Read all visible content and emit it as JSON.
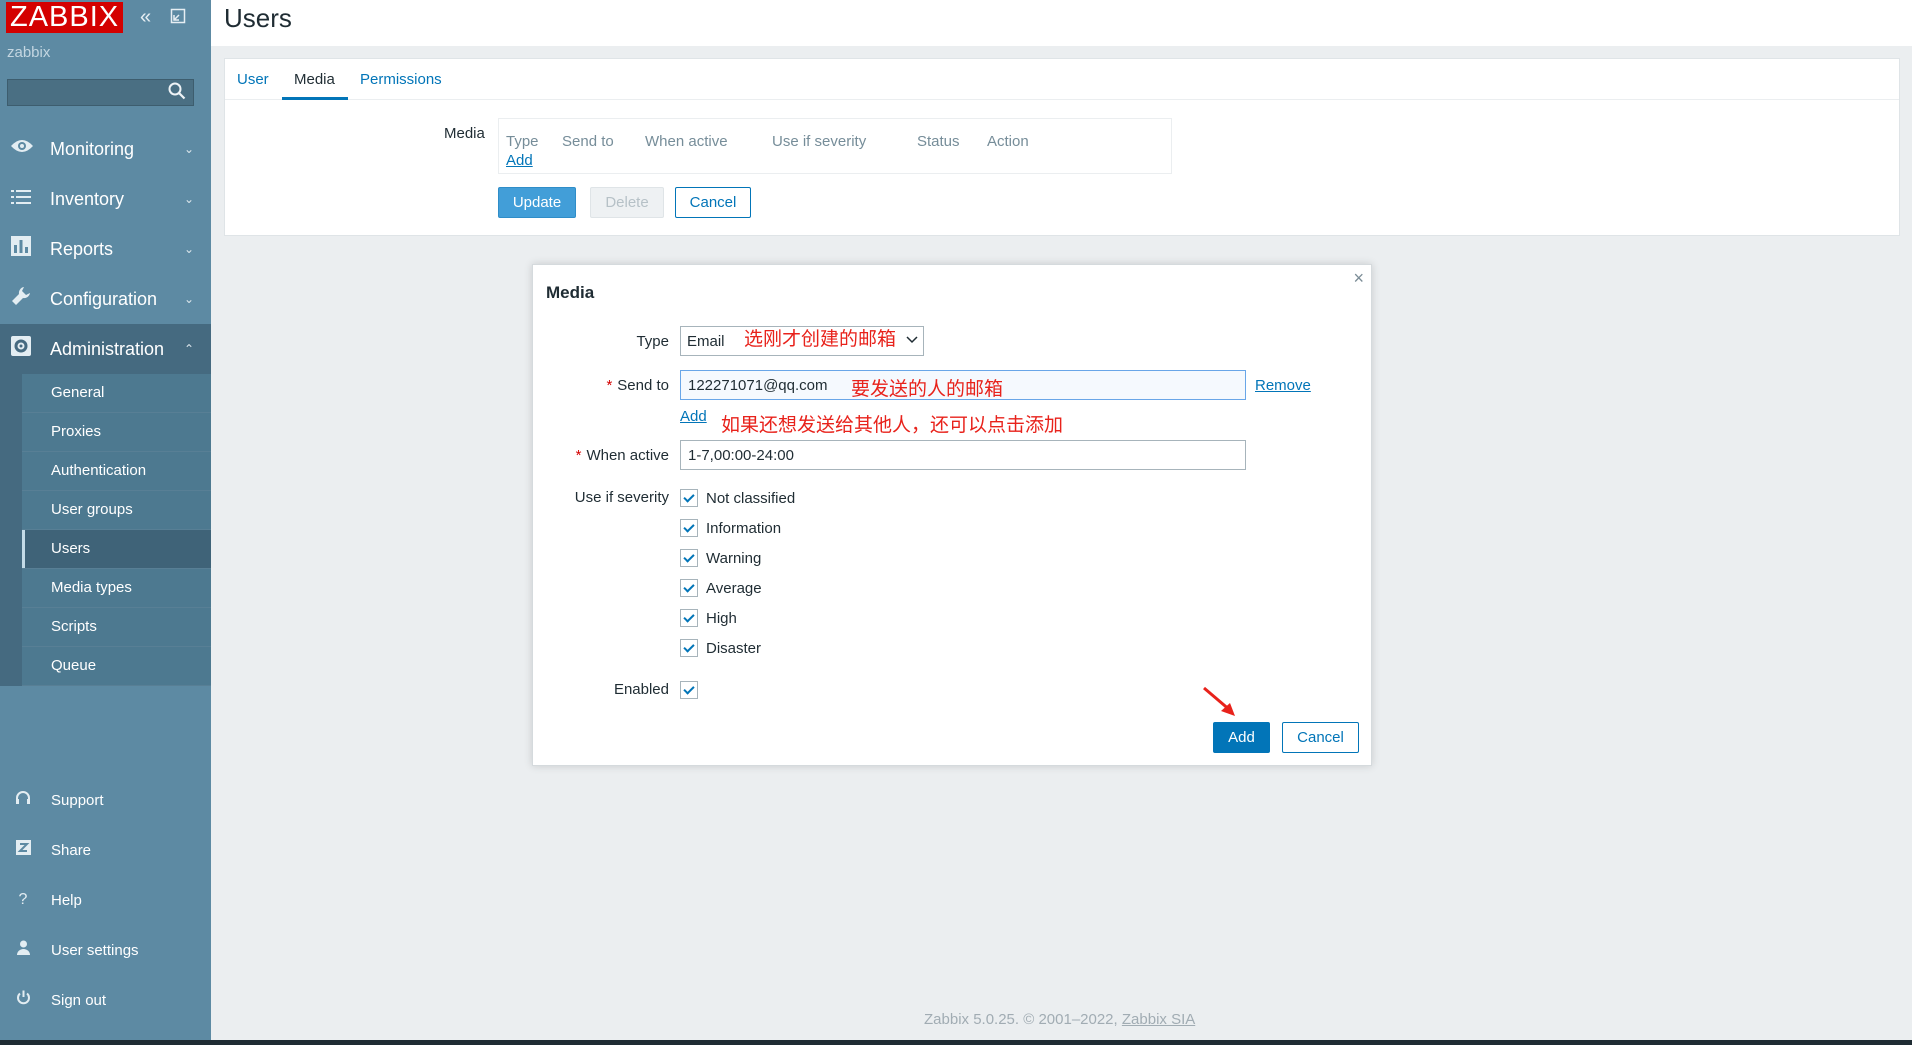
{
  "sidebar": {
    "logo": "ZABBIX",
    "server": "zabbix",
    "menu": [
      {
        "label": "Monitoring",
        "icon": "eye-icon"
      },
      {
        "label": "Inventory",
        "icon": "list-icon"
      },
      {
        "label": "Reports",
        "icon": "bar-chart-icon"
      },
      {
        "label": "Configuration",
        "icon": "wrench-icon"
      },
      {
        "label": "Administration",
        "icon": "gear-icon"
      }
    ],
    "submenu": [
      "General",
      "Proxies",
      "Authentication",
      "User groups",
      "Users",
      "Media types",
      "Scripts",
      "Queue"
    ],
    "selected_submenu": "Users",
    "bottom": [
      {
        "label": "Support",
        "icon": "headset-icon"
      },
      {
        "label": "Share",
        "icon": "share-z-icon"
      },
      {
        "label": "Help",
        "icon": "help-icon"
      },
      {
        "label": "User settings",
        "icon": "user-icon"
      },
      {
        "label": "Sign out",
        "icon": "power-icon"
      }
    ]
  },
  "header": {
    "title": "Users"
  },
  "tabs": [
    "User",
    "Media",
    "Permissions"
  ],
  "active_tab": "Media",
  "media_section": {
    "label": "Media",
    "columns": [
      "Type",
      "Send to",
      "When active",
      "Use if severity",
      "Status",
      "Action"
    ],
    "add_link": "Add"
  },
  "form_buttons": {
    "update": "Update",
    "delete": "Delete",
    "cancel": "Cancel"
  },
  "dialog": {
    "title": "Media",
    "close": "×",
    "type_label": "Type",
    "type_value": "Email",
    "send_to_label": "Send to",
    "send_to_value": "122271071@qq.com",
    "remove_link": "Remove",
    "add_link": "Add",
    "when_active_label": "When active",
    "when_active_value": "1-7,00:00-24:00",
    "severity_label": "Use if severity",
    "severities": [
      "Not classified",
      "Information",
      "Warning",
      "Average",
      "High",
      "Disaster"
    ],
    "enabled_label": "Enabled",
    "add_button": "Add",
    "cancel_button": "Cancel"
  },
  "annotations": {
    "type_note": "选刚才创建的邮箱",
    "send_note": "要发送的人的邮箱",
    "add_note": "如果还想发送给其他人，还可以点击添加"
  },
  "footer": {
    "text": "Zabbix 5.0.25. © 2001–2022,",
    "link": "Zabbix SIA"
  },
  "colors": {
    "sidebar": "#5d8aa3",
    "accent": "#0275b8",
    "logo": "#d40000",
    "annotation": "#e8221b"
  }
}
